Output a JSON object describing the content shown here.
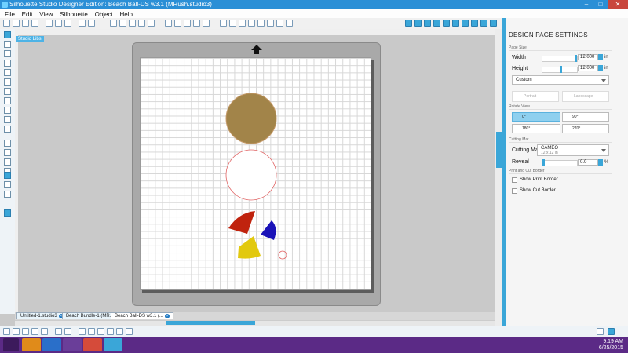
{
  "window": {
    "title": "Silhouette Studio Designer Edition: Beach Ball-DS w3.1 (MRush.studio3)",
    "controls": [
      "–",
      "□",
      "✕"
    ]
  },
  "menu": [
    "File",
    "Edit",
    "View",
    "Silhouette",
    "Object",
    "Help"
  ],
  "canvas": {
    "tag": "Studio Libs",
    "shapes": {
      "top_circle_color": "#a28449",
      "middle_circle_color": "#ffffff",
      "outline_color": "#e26565",
      "red_wedge_color": "#c0230e",
      "blue_wedge_color": "#1a12b8",
      "yellow_wedge_color": "#e2c90f"
    }
  },
  "tabs": [
    {
      "label": "Untitled-1.studio3"
    },
    {
      "label": "Beach Bundle-1 (MR..."
    },
    {
      "label": "Beach Ball-DS w3.1 (..."
    }
  ],
  "panel": {
    "title": "DESIGN PAGE SETTINGS",
    "page_size_header": "Page Size",
    "width_label": "Width",
    "width_value": "12.000",
    "width_unit": "in",
    "height_label": "Height",
    "height_value": "12.000",
    "height_unit": "in",
    "size_select": "Custom",
    "portrait": "Portrait",
    "landscape": "Landscape",
    "rotate_header": "Rotate View",
    "rot_0": "0°",
    "rot_90": "90°",
    "rot_180": "180°",
    "rot_270": "270°",
    "cutting_mat_header": "Cutting Mat",
    "cutting_mat_label": "Cutting Mat",
    "cutting_mat_value": "CAMEO",
    "cutting_mat_sub": "12 x 12 in",
    "reveal_label": "Reveal",
    "reveal_value": "0.0",
    "reveal_unit": "%",
    "borders_header": "Print and Cut Border",
    "show_print_border": "Show Print Border",
    "show_cut_border": "Show Cut Border"
  },
  "taskbar": {
    "time": "9:19 AM",
    "date": "6/25/2015"
  }
}
